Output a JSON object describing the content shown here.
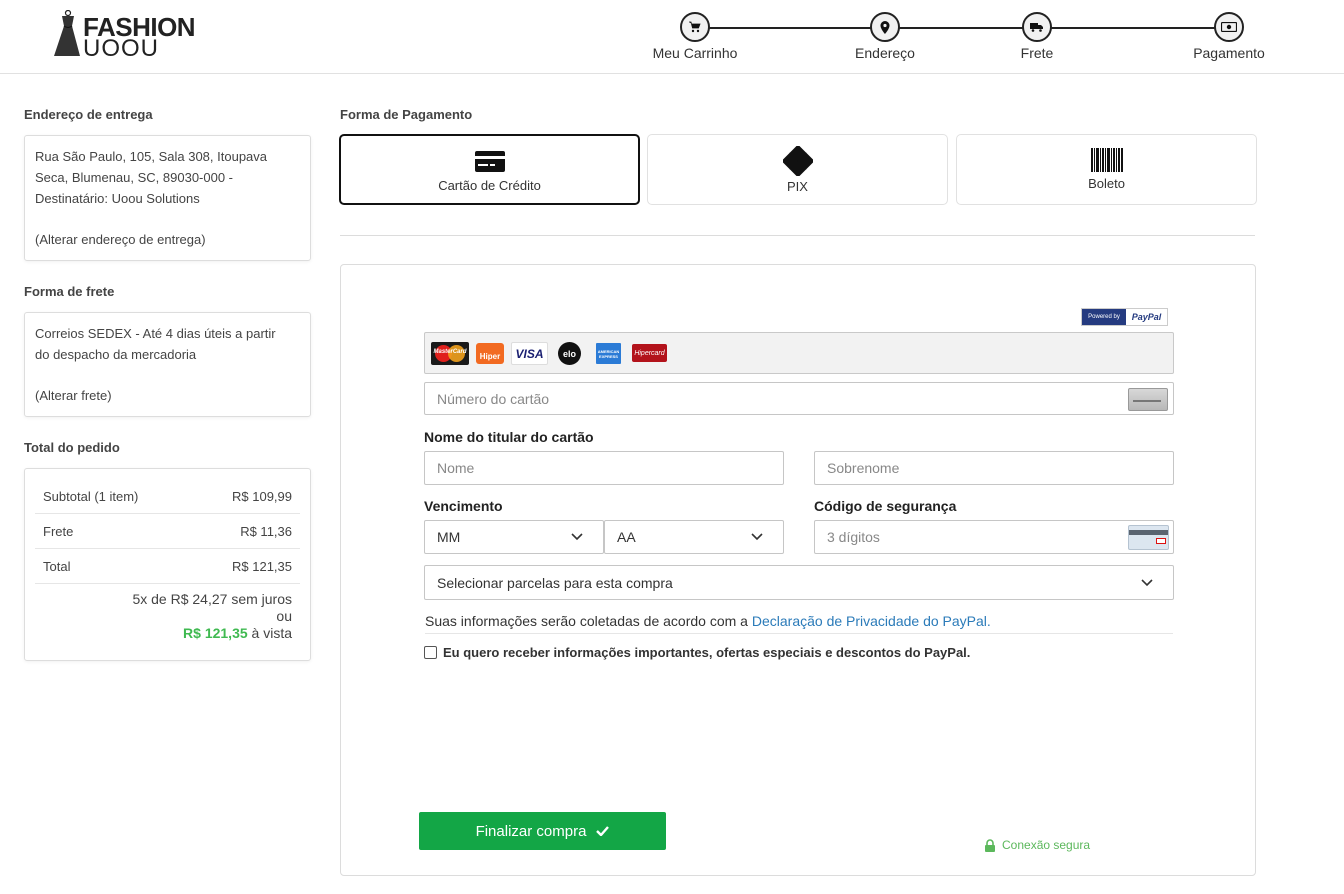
{
  "brand": {
    "line1": "FASHION",
    "line2": "UOOU"
  },
  "steps": [
    {
      "label": "Meu Carrinho",
      "icon": "cart-icon"
    },
    {
      "label": "Endereço",
      "icon": "map-pin-icon"
    },
    {
      "label": "Frete",
      "icon": "truck-icon"
    },
    {
      "label": "Pagamento",
      "icon": "money-icon"
    }
  ],
  "address": {
    "title": "Endereço de entrega",
    "lines": [
      "Rua São Paulo, 105, Sala 308, Itoupava",
      "Seca, Blumenau, SC, 89030-000 -",
      "Destinatário: Uoou Solutions"
    ],
    "change": "(Alterar endereço de entrega)"
  },
  "shipping": {
    "title": "Forma de frete",
    "lines": [
      "Correios SEDEX - Até 4 dias úteis a partir",
      "do despacho da mercadoria"
    ],
    "change": "(Alterar frete)"
  },
  "totals": {
    "title": "Total do pedido",
    "rows": [
      {
        "label": "Subtotal (1 item)",
        "value": "R$ 109,99"
      },
      {
        "label": "Frete",
        "value": "R$ 11,36"
      },
      {
        "label": "Total",
        "value": "R$ 121,35"
      }
    ],
    "installments": "5x de R$ 24,27 sem juros",
    "or": "ou",
    "cash_value": "R$ 121,35",
    "cash_suffix": " à vista"
  },
  "payment": {
    "title": "Forma de Pagamento",
    "tabs": [
      {
        "label": "Cartão de Crédito",
        "icon": "credit-card-icon",
        "active": true
      },
      {
        "label": "PIX",
        "icon": "pix-icon",
        "active": false
      },
      {
        "label": "Boleto",
        "icon": "barcode-icon",
        "active": false
      }
    ]
  },
  "form": {
    "paypal_badge": {
      "powered": "Powered by",
      "brand": "PayPal"
    },
    "card_brands": [
      "MasterCard",
      "Hiper",
      "VISA",
      "elo",
      "AMERICAN EXPRESS",
      "Hipercard"
    ],
    "card_number_placeholder": "Número do cartão",
    "holder_label": "Nome do titular do cartão",
    "first_name_placeholder": "Nome",
    "last_name_placeholder": "Sobrenome",
    "expiry_label": "Vencimento",
    "month_value": "MM",
    "year_value": "AA",
    "cvv_label": "Código de segurança",
    "cvv_placeholder": "3 dígitos",
    "installments_select": "Selecionar parcelas para esta compra",
    "privacy_text": "Suas informações serão coletadas de acordo com a ",
    "privacy_link": "Declaração de Privacidade do PayPal.",
    "optin_label": "Eu quero receber informações importantes, ofertas especiais e descontos do PayPal.",
    "submit_label": "Finalizar compra",
    "secure_label": "Conexão segura"
  },
  "colors": {
    "accent_green": "#13a646",
    "price_green": "#3fb950",
    "link_blue": "#2b7bb9",
    "paypal_navy": "#253b80"
  }
}
